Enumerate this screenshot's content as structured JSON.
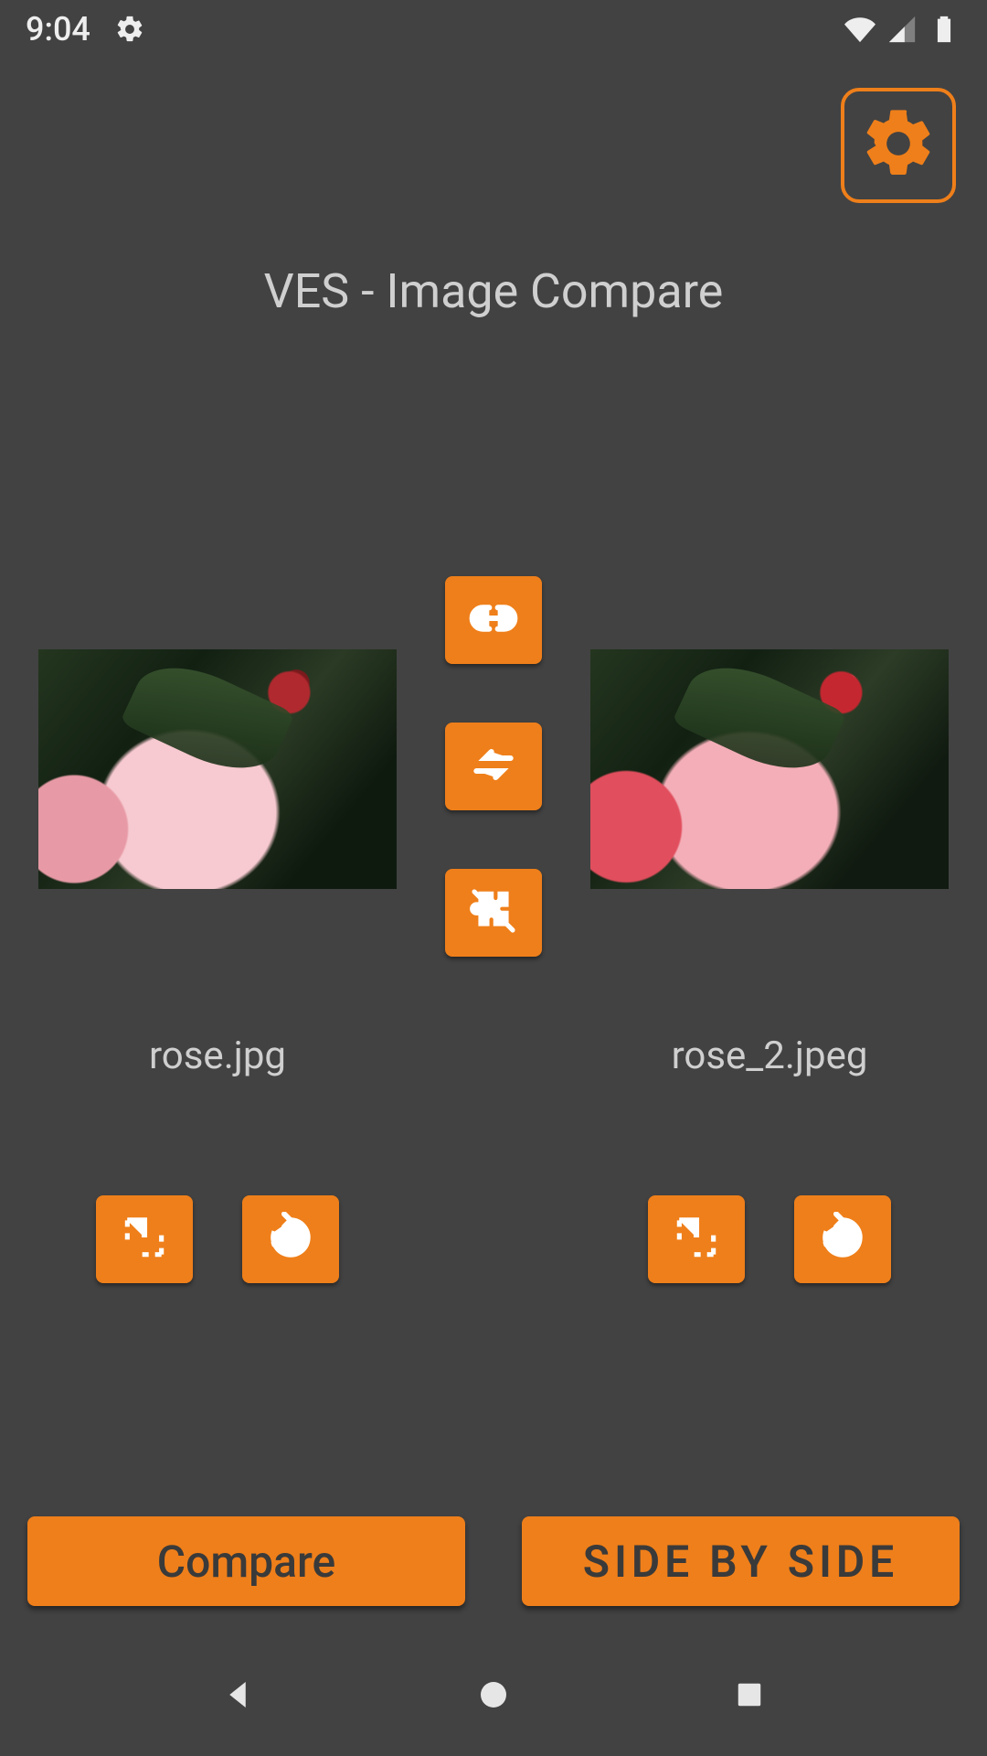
{
  "statusbar": {
    "time": "9:04"
  },
  "title": "VES - Image Compare",
  "left": {
    "filename": "rose.jpg"
  },
  "right": {
    "filename": "rose_2.jpeg"
  },
  "buttons": {
    "compare": "Compare",
    "sidebyside": "SIDE BY SIDE"
  }
}
